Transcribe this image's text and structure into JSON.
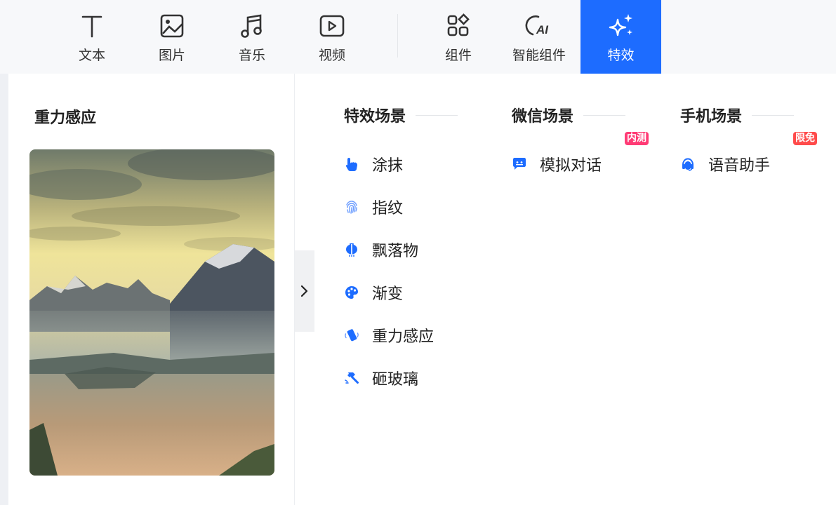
{
  "toolbar": {
    "items": [
      {
        "label": "文本",
        "icon": "text-icon"
      },
      {
        "label": "图片",
        "icon": "image-icon"
      },
      {
        "label": "音乐",
        "icon": "music-icon"
      },
      {
        "label": "视频",
        "icon": "video-icon"
      },
      {
        "label": "组件",
        "icon": "components-icon"
      },
      {
        "label": "智能组件",
        "icon": "ai-icon"
      },
      {
        "label": "特效",
        "icon": "sparkle-icon"
      }
    ],
    "active": "特效",
    "accent": "#1d6cff"
  },
  "preview": {
    "title": "重力感应"
  },
  "categories": [
    {
      "title": "特效场景",
      "items": [
        {
          "label": "涂抹",
          "icon": "hand-pointer-icon"
        },
        {
          "label": "指纹",
          "icon": "fingerprint-icon"
        },
        {
          "label": "飘落物",
          "icon": "lantern-icon"
        },
        {
          "label": "渐变",
          "icon": "palette-icon"
        },
        {
          "label": "重力感应",
          "icon": "phone-shake-icon"
        },
        {
          "label": "砸玻璃",
          "icon": "hammer-icon"
        }
      ]
    },
    {
      "title": "微信场景",
      "items": [
        {
          "label": "模拟对话",
          "icon": "chat-icon",
          "badge": "内测"
        }
      ]
    },
    {
      "title": "手机场景",
      "items": [
        {
          "label": "语音助手",
          "icon": "headset-icon",
          "badge": "限免"
        }
      ]
    }
  ],
  "colors": {
    "icon_blue": "#1d6cff",
    "badge_pink": "#ff3b75",
    "badge_red": "#ff4b4b"
  }
}
